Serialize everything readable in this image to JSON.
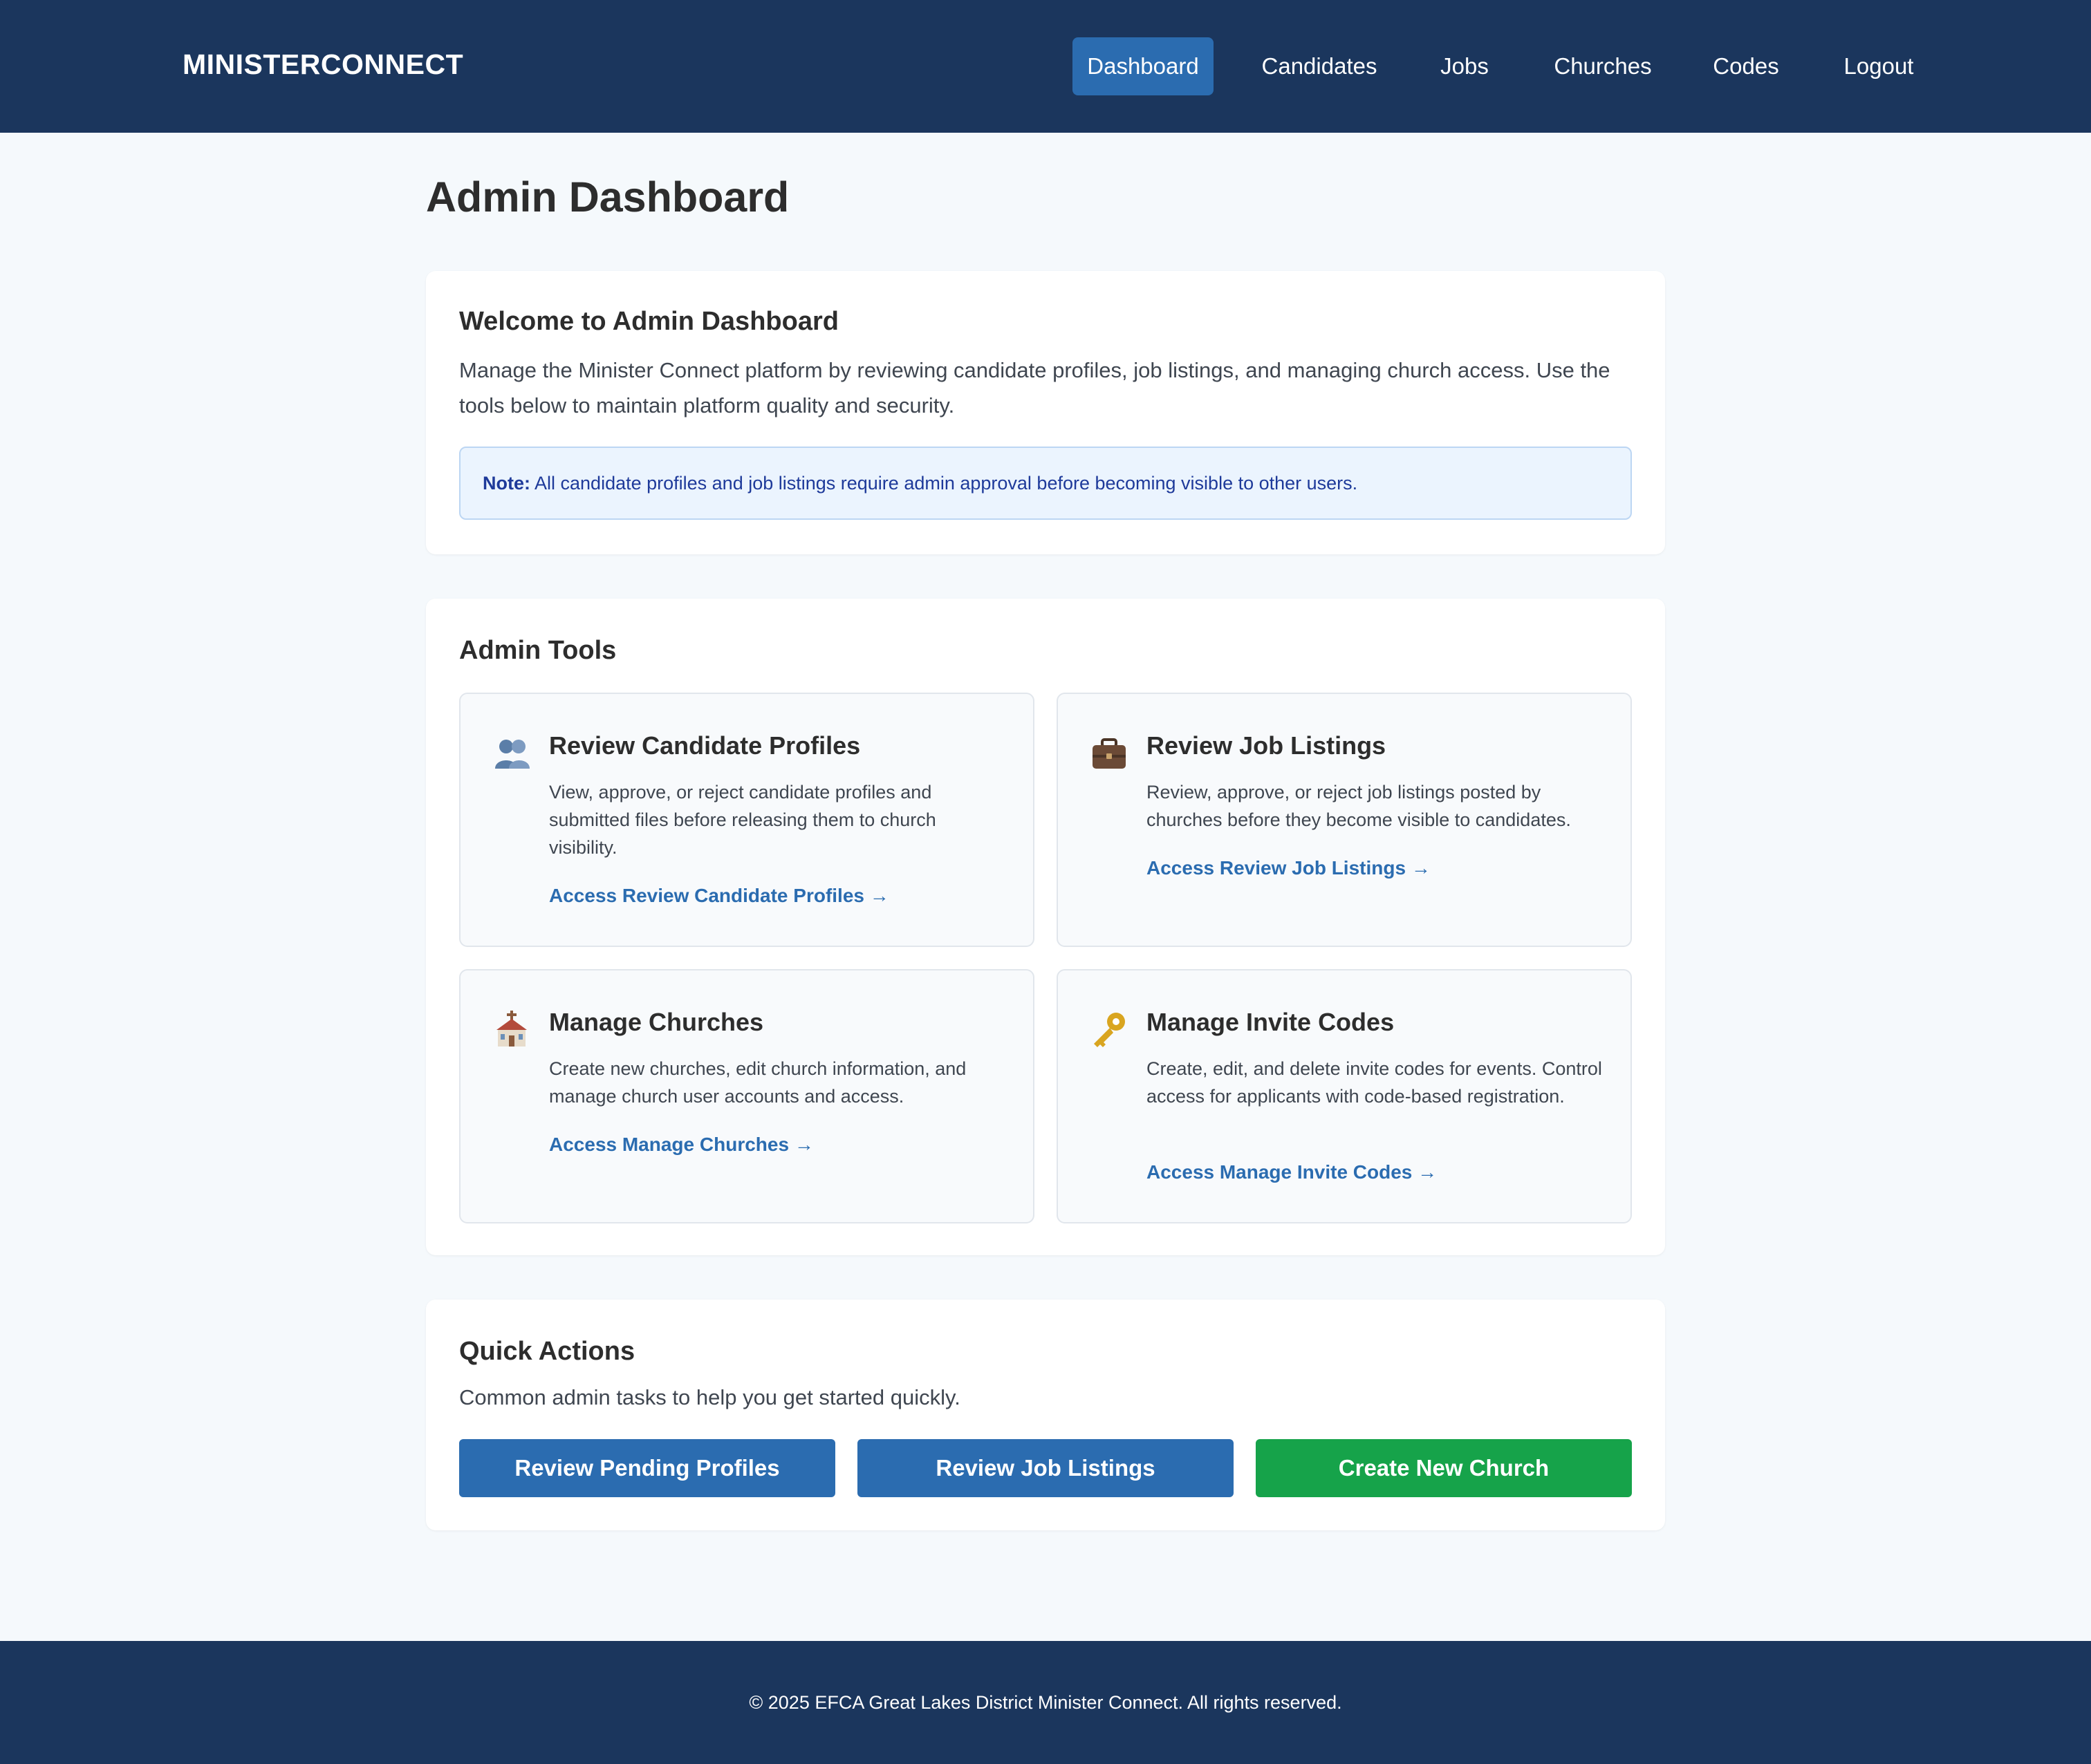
{
  "header": {
    "brand": "MINISTERCONNECT",
    "nav": [
      {
        "label": "Dashboard",
        "active": true
      },
      {
        "label": "Candidates",
        "active": false
      },
      {
        "label": "Jobs",
        "active": false
      },
      {
        "label": "Churches",
        "active": false
      },
      {
        "label": "Codes",
        "active": false
      },
      {
        "label": "Logout",
        "active": false
      }
    ]
  },
  "page_title": "Admin Dashboard",
  "welcome": {
    "heading": "Welcome to Admin Dashboard",
    "body": "Manage the Minister Connect platform by reviewing candidate profiles, job listings, and managing church access. Use the tools below to maintain platform quality and security.",
    "note_label": "Note:",
    "note_text": " All candidate profiles and job listings require admin approval before becoming visible to other users."
  },
  "admin_tools": {
    "heading": "Admin Tools",
    "tools": [
      {
        "icon": "people-icon",
        "title": "Review Candidate Profiles",
        "description": "View, approve, or reject candidate profiles and submitted files before releasing them to church visibility.",
        "link": "Access Review Candidate Profiles →"
      },
      {
        "icon": "briefcase-icon",
        "title": "Review Job Listings",
        "description": "Review, approve, or reject job listings posted by churches before they become visible to candidates.",
        "link": "Access Review Job Listings →"
      },
      {
        "icon": "church-icon",
        "title": "Manage Churches",
        "description": "Create new churches, edit church information, and manage church user accounts and access.",
        "link": "Access Manage Churches →"
      },
      {
        "icon": "key-icon",
        "title": "Manage Invite Codes",
        "description": "Create, edit, and delete invite codes for events. Control access for applicants with code-based registration.",
        "link": "Access Manage Invite Codes →"
      }
    ]
  },
  "quick_actions": {
    "heading": "Quick Actions",
    "description": "Common admin tasks to help you get started quickly.",
    "buttons": [
      {
        "label": "Review Pending Profiles",
        "color": "#2b6cb0"
      },
      {
        "label": "Review Job Listings",
        "color": "#2b6cb0"
      },
      {
        "label": "Create New Church",
        "color": "#16a34a"
      }
    ]
  },
  "colors": {
    "navy": "#1b365d",
    "primary": "#2b6cb0",
    "success": "#16a34a",
    "page_bg": "#f5f9fc"
  },
  "footer": {
    "text": "© 2025 EFCA Great Lakes District Minister Connect. All rights reserved."
  }
}
